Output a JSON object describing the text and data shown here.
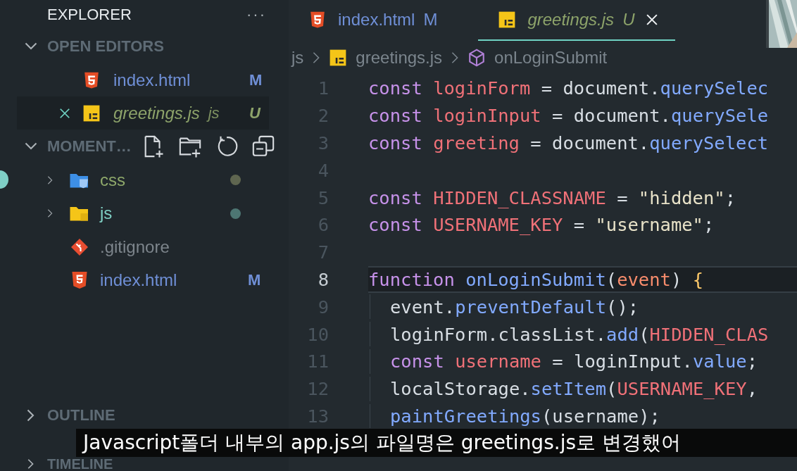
{
  "sidebar": {
    "title": "EXPLORER",
    "more": "···",
    "open_editors": {
      "label": "OPEN EDITORS",
      "expanded": true,
      "items": [
        {
          "name": "index.html",
          "kind": "html",
          "badge": "M",
          "color": "#6f8fd6",
          "preview": false,
          "selected": false
        },
        {
          "name": "greetings.js",
          "kind": "js",
          "description": "js",
          "badge": "U",
          "color": "#8da36a",
          "preview": true,
          "selected": true
        }
      ]
    },
    "folder": {
      "label": "MOMENT…",
      "expanded": true,
      "items": [
        {
          "name": "css",
          "kind": "css-folder",
          "color": "#8fa96b",
          "dot": {
            "color": "#5f6650"
          },
          "expanded": false
        },
        {
          "name": "js",
          "kind": "js-folder",
          "color": "#7fd0c4",
          "dot": {
            "color": "#4d7673"
          },
          "expanded": false
        },
        {
          "name": ".gitignore",
          "kind": "git",
          "color": "#7d858c"
        },
        {
          "name": "index.html",
          "kind": "html",
          "color": "#6f8fd6",
          "badge": "M"
        }
      ]
    },
    "outline": {
      "label": "OUTLINE",
      "expanded": false
    },
    "timeline": {
      "label": "TIMELINE",
      "expanded": false
    }
  },
  "tabs": [
    {
      "label": "index.html",
      "kind": "html",
      "badge": "M",
      "color": "#6f8fd6",
      "preview": false,
      "selected": false
    },
    {
      "label": "greetings.js",
      "kind": "js",
      "badge": "U",
      "color": "#8da36a",
      "preview": true,
      "selected": true
    }
  ],
  "breadcrumb": [
    {
      "label": "js",
      "kind": "folder"
    },
    {
      "label": "greetings.js",
      "kind": "file"
    },
    {
      "label": "onLoginSubmit",
      "kind": "symbol"
    }
  ],
  "code": [
    {
      "number": "1",
      "current": false,
      "indented": false,
      "text": "const loginForm = document.querySelec"
    },
    {
      "number": "2",
      "current": false,
      "indented": false,
      "text": "const loginInput = document.querySele"
    },
    {
      "number": "3",
      "current": false,
      "indented": false,
      "text": "const greeting = document.querySelect"
    },
    {
      "number": "4",
      "current": false
    },
    {
      "number": "5",
      "current": false,
      "indented": false,
      "text": "const HIDDEN_CLASSNAME = \"hidden\";"
    },
    {
      "number": "6",
      "current": false,
      "indented": false,
      "text": "const USERNAME_KEY = \"username\";"
    },
    {
      "number": "7",
      "current": false
    },
    {
      "number": "8",
      "current": true,
      "indented": false,
      "text": "function onLoginSubmit(event) {"
    },
    {
      "number": "9",
      "current": false,
      "indented": true,
      "text": "event.preventDefault();"
    },
    {
      "number": "10",
      "current": false,
      "indented": true,
      "text": "loginForm.classList.add(HIDDEN_CLAS"
    },
    {
      "number": "11",
      "current": false,
      "indented": true,
      "text": "const username = loginInput.value;"
    },
    {
      "number": "12",
      "current": false,
      "indented": true,
      "text": "localStorage.setItem(USERNAME_KEY,"
    },
    {
      "number": "13",
      "current": false,
      "indented": true,
      "text": "paintGreetings(username);"
    }
  ],
  "subtitle": "Javascript폴더 내부의 app.js의 파일명은 greetings.js로 변경했어"
}
